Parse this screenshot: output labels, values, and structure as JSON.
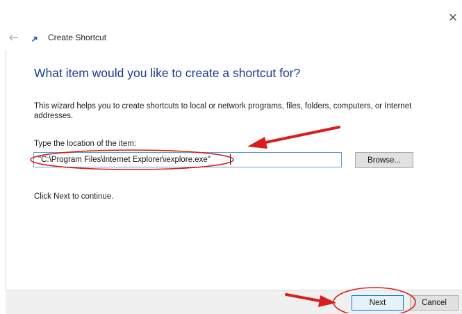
{
  "window": {
    "title": "Create Shortcut",
    "close_icon": "close-icon",
    "back_icon": "back-arrow-icon",
    "app_icon": "shortcut-app-icon"
  },
  "wizard": {
    "heading": "What item would you like to create a shortcut for?",
    "description": "This wizard helps you to create shortcuts to local or network programs, files, folders, computers, or Internet addresses.",
    "location_label": "Type the location of the item:",
    "location_value": "\"C:\\Program Files\\Internet Explorer\\iexplore.exe\"",
    "browse_label": "Browse...",
    "continue_text": "Click Next to continue."
  },
  "footer": {
    "next_label": "Next",
    "cancel_label": "Cancel"
  },
  "colors": {
    "heading": "#1a3d8f",
    "annotation": "#d81e1e",
    "primary_border": "#0078d7"
  }
}
